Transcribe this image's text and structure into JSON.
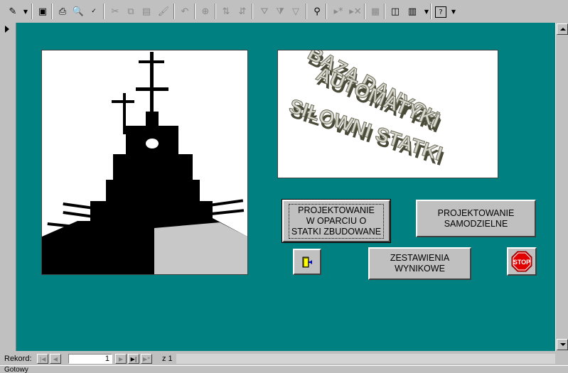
{
  "toolbar": {
    "icons": [
      "design-view",
      "save",
      "print",
      "print-preview",
      "spelling",
      "cut",
      "copy",
      "paste",
      "format-painter",
      "undo",
      "insert-hyperlink",
      "sort-ascending",
      "sort-descending",
      "filter-by-selection",
      "filter-by-form",
      "apply-filter",
      "find",
      "new-record",
      "delete-record",
      "properties",
      "database-window",
      "new-object",
      "help"
    ]
  },
  "banner": {
    "line1": "BAZA DANYCH",
    "line2": "AUTOMATYKI",
    "line3": "SIŁOWNI STATKI"
  },
  "buttons": {
    "projektowanie_oparciu": "PROJEKTOWANIE\nW OPARCIU O\nSTATKI ZBUDOWANE",
    "projektowanie_samodzielne": "PROJEKTOWANIE\nSAMODZIELNE",
    "zestawienia": "ZESTAWIENIA\nWYNIKOWE",
    "stop": "STOP"
  },
  "nav": {
    "label": "Rekord:",
    "current": "1",
    "of": "z  1"
  },
  "status": {
    "text": "Gotowy"
  },
  "colors": {
    "form_background": "#008080",
    "window_gray": "#c0c0c0",
    "stop_red": "#e00000"
  }
}
